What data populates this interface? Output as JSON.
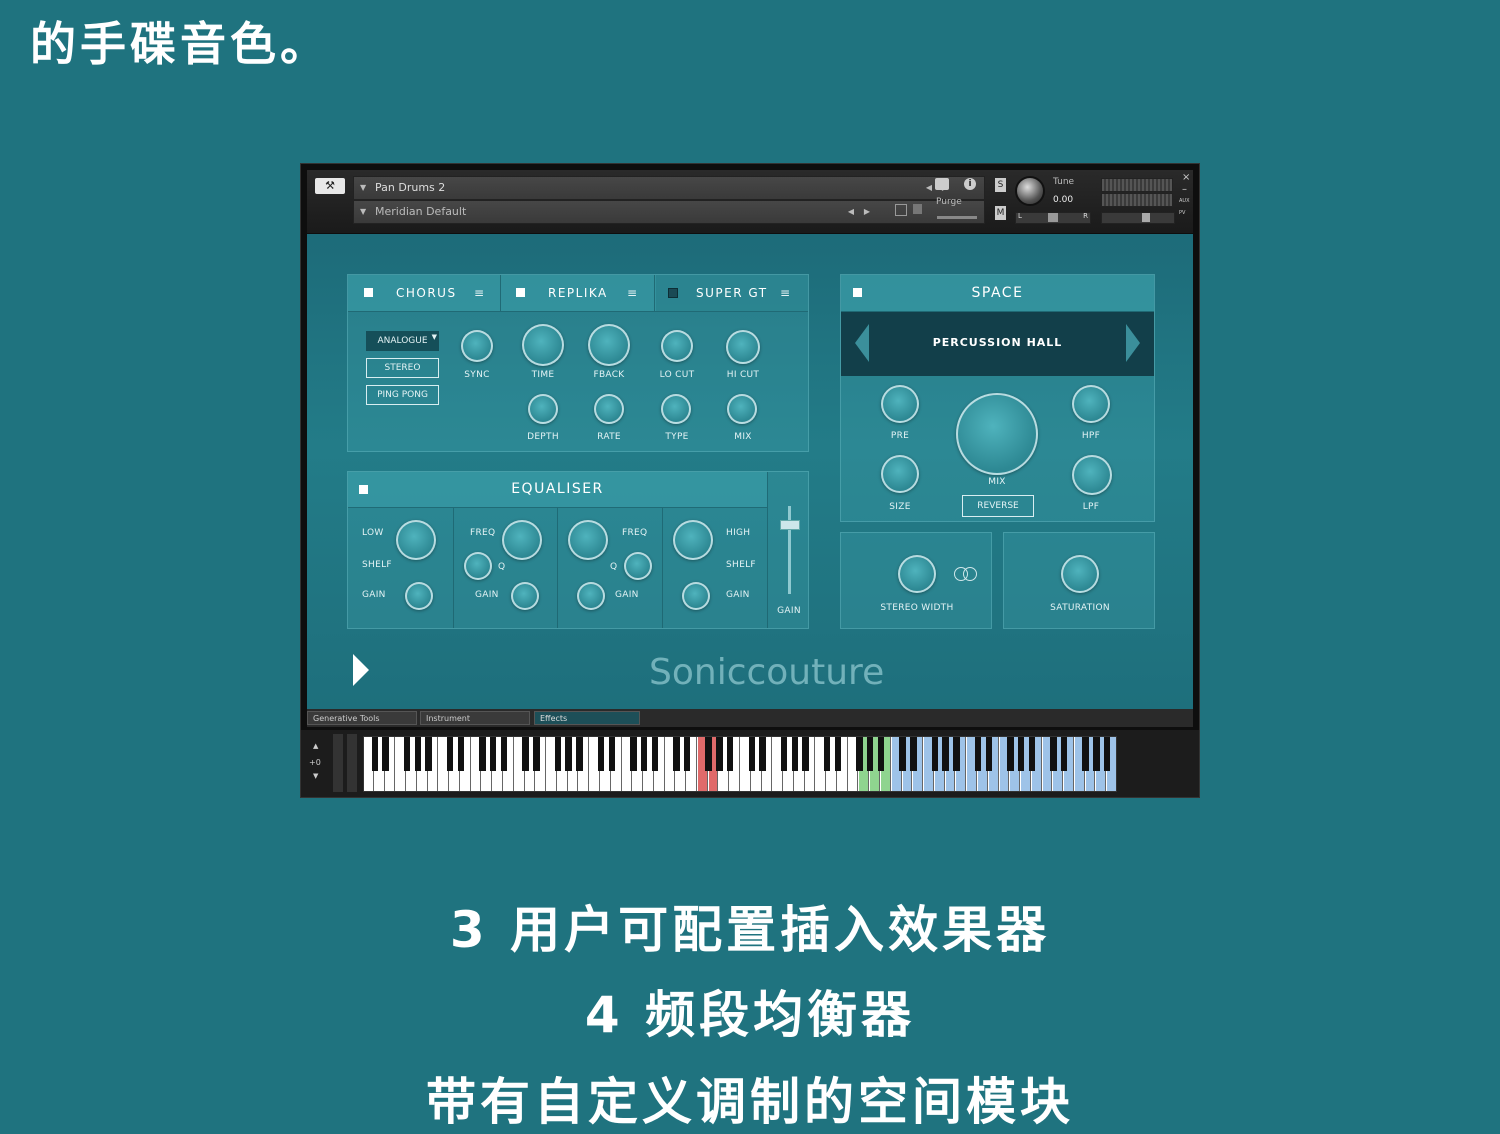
{
  "caption_top": "的手碟音色。",
  "caption_line1": "3 用户可配置插入效果器",
  "caption_line2": "4 频段均衡器",
  "caption_line3": "带有自定义调制的空间模块",
  "header": {
    "instrument_name": "Pan Drums 2",
    "snapshot_name": "Meridian Default",
    "purge_label": "Purge",
    "tune_label": "Tune",
    "tune_value": "0.00",
    "solo_label": "S",
    "mute_label": "M",
    "pan_left": "L",
    "pan_right": "R",
    "aux_label": "AUX",
    "pv_label": "PV"
  },
  "fx_tabs": [
    {
      "label": "CHORUS",
      "enabled": true
    },
    {
      "label": "REPLIKA",
      "enabled": true
    },
    {
      "label": "SUPER GT",
      "enabled": false
    }
  ],
  "replika": {
    "mode_select": "ANALOGUE",
    "stereo_button": "STEREO",
    "pingpong_button": "PING PONG",
    "knobs_row1": [
      "SYNC",
      "TIME",
      "FBACK",
      "LO CUT",
      "HI CUT"
    ],
    "knobs_row2": [
      "DEPTH",
      "RATE",
      "TYPE",
      "MIX"
    ]
  },
  "equaliser": {
    "title": "EQUALISER",
    "band1": {
      "top": "LOW",
      "mid": "SHELF",
      "bottom": "GAIN"
    },
    "band2": {
      "top": "FREQ",
      "mid": "Q",
      "bottom": "GAIN"
    },
    "band3": {
      "top": "FREQ",
      "mid": "Q",
      "bottom": "GAIN"
    },
    "band4": {
      "top": "HIGH",
      "mid": "SHELF",
      "bottom": "GAIN"
    },
    "gain_label": "GAIN"
  },
  "space": {
    "title": "SPACE",
    "preset": "PERCUSSION HALL",
    "pre": "PRE",
    "hpf": "HPF",
    "mix": "MIX",
    "size": "SIZE",
    "lpf": "LPF",
    "reverse_button": "REVERSE"
  },
  "stereo_width": "STEREO WIDTH",
  "saturation": "SATURATION",
  "brand": "Soniccouture",
  "bottom_tabs": [
    "Generative Tools",
    "Instrument",
    "Effects"
  ],
  "octave_value": "+0",
  "colors": {
    "background": "#1f737f",
    "panel": "#237c88",
    "key_red": "#e06a6a",
    "key_green": "#8fd48f",
    "key_blue": "#9ec3e8"
  }
}
